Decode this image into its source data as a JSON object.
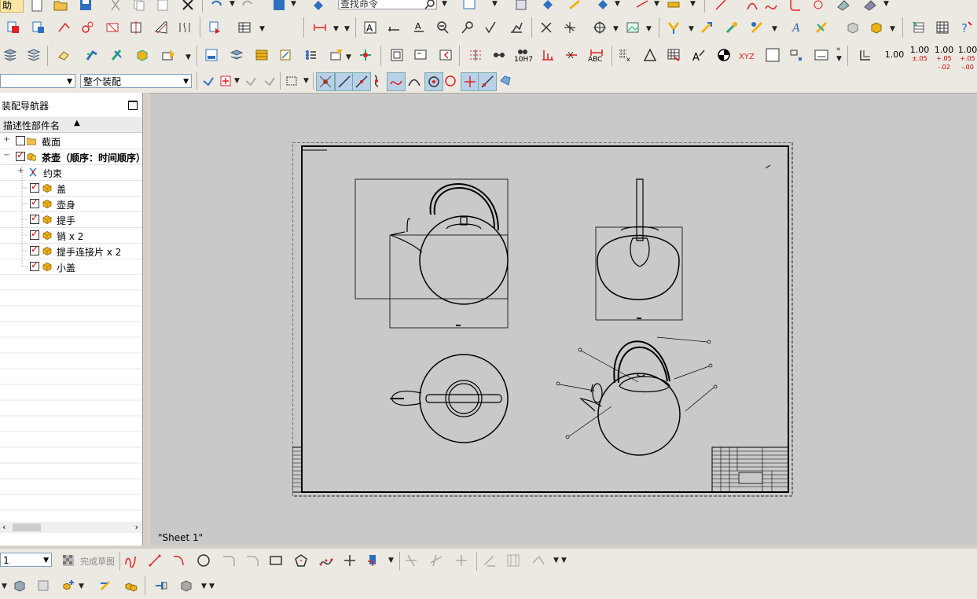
{
  "app": {
    "colors": {
      "accent": "#d22",
      "toolbar_bg": "#ece9e2",
      "canvas_bg": "#c9c9c9",
      "icon_blue": "#2f6fc0",
      "icon_yellow": "#f0b21a"
    }
  },
  "toolbar": {
    "menu_partial": "助",
    "search_placeholder": "查找命令",
    "numeric_buttons": [
      {
        "main": "1.00",
        "sub": ""
      },
      {
        "main": "1.00",
        "sub": "±.05"
      },
      {
        "main": "1.00",
        "sub": "+.05 -.02"
      },
      {
        "main": "1.00",
        "sub": "+.05 -.00"
      }
    ],
    "text_abc": "ABC",
    "text_xyz": "XYZ",
    "text_10h7": "10H7"
  },
  "filter_bar": {
    "filter_combo_value": "",
    "scope_combo_value": "整个装配"
  },
  "navigator": {
    "title": "装配导航器",
    "column_header": "描述性部件名",
    "items": [
      {
        "label": "截面",
        "level": 0,
        "checked": false,
        "expander": "+",
        "icon": "folder-icon",
        "bold": false
      },
      {
        "label": "茶壶（顺序：时间顺序）",
        "level": 0,
        "checked": true,
        "expander": "−",
        "icon": "assembly-icon",
        "bold": true
      },
      {
        "label": "约束",
        "level": 1,
        "checked": null,
        "expander": "+",
        "icon": "constraint-icon",
        "bold": false
      },
      {
        "label": "盖",
        "level": 1,
        "checked": true,
        "expander": "",
        "icon": "part-icon",
        "bold": false
      },
      {
        "label": "壶身",
        "level": 1,
        "checked": true,
        "expander": "",
        "icon": "part-icon",
        "bold": false
      },
      {
        "label": "提手",
        "level": 1,
        "checked": true,
        "expander": "",
        "icon": "part-icon",
        "bold": false
      },
      {
        "label": "销 x 2",
        "level": 1,
        "checked": true,
        "expander": "",
        "icon": "part-icon",
        "bold": false
      },
      {
        "label": "提手连接片 x 2",
        "level": 1,
        "checked": true,
        "expander": "",
        "icon": "part-icon",
        "bold": false
      },
      {
        "label": "小盖",
        "level": 1,
        "checked": true,
        "expander": "",
        "icon": "part-icon",
        "bold": false
      }
    ]
  },
  "drawing": {
    "sheet_label": "\"Sheet 1\""
  },
  "sketch_bar": {
    "combo_value": "1",
    "finish_sketch_label": "完成草图"
  }
}
